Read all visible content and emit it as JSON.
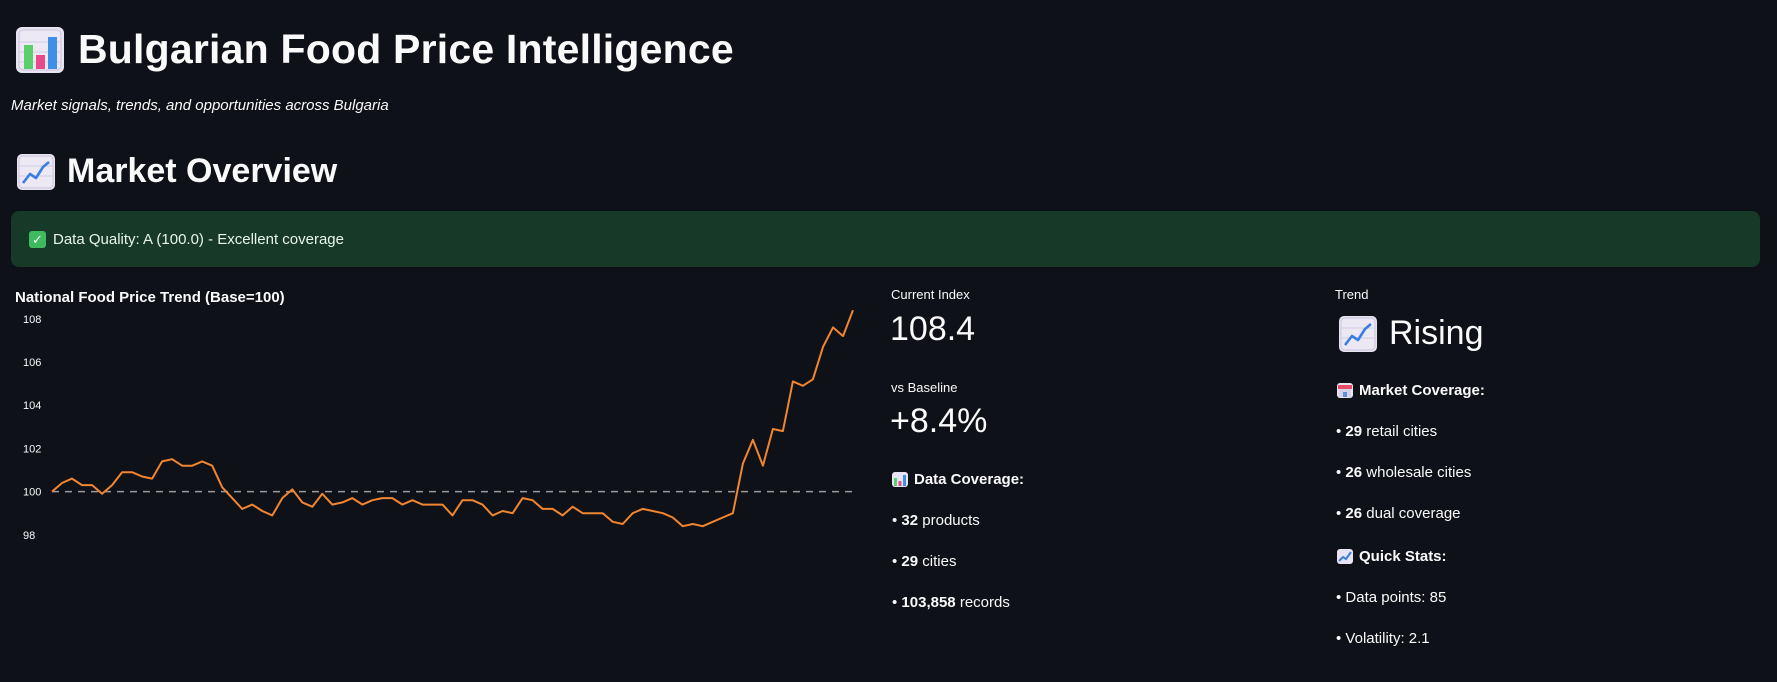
{
  "header": {
    "title": "Bulgarian Food Price Intelligence",
    "title_icon": "bar-chart-icon",
    "subtitle": "Market signals, trends, and opportunities across Bulgaria"
  },
  "section": {
    "title": "Market Overview",
    "icon": "chart-increasing-icon"
  },
  "alert": {
    "text": "Data Quality: A (100.0) - Excellent coverage",
    "icon": "check-mark-icon",
    "background": "#173928"
  },
  "colors": {
    "background": "#0e1117",
    "line": "#f2852f",
    "baseline": "#9a9a9a"
  },
  "metrics": {
    "current_index_label": "Current Index",
    "current_index_value": "108.4",
    "baseline_label": "vs Baseline",
    "baseline_value": "+8.4%",
    "trend_label": "Trend",
    "trend_value": "Rising",
    "trend_icon": "chart-increasing-icon"
  },
  "data_coverage": {
    "heading": "Data Coverage:",
    "icon": "bar-chart-icon",
    "items": [
      {
        "value": "32",
        "text": " products"
      },
      {
        "value": "29",
        "text": " cities"
      },
      {
        "value": "103,858",
        "text": " records"
      }
    ]
  },
  "market_coverage": {
    "heading": "Market Coverage:",
    "icon": "store-icon",
    "items": [
      {
        "value": "29",
        "text": " retail cities"
      },
      {
        "value": "26",
        "text": " wholesale cities"
      },
      {
        "value": "26",
        "text": " dual coverage"
      }
    ]
  },
  "quick_stats": {
    "heading": "Quick Stats:",
    "icon": "chart-increasing-icon",
    "items": [
      "• Data points: 85",
      "• Volatility: 2.1"
    ]
  },
  "bullet_prefix": "• ",
  "chart_data": {
    "type": "line",
    "title": "National Food Price Trend (Base=100)",
    "xlabel": "",
    "ylabel": "",
    "ylim": [
      97,
      109
    ],
    "yticks": [
      98,
      100,
      102,
      104,
      106,
      108
    ],
    "baseline": 100,
    "grid": false,
    "x": [
      1,
      2,
      3,
      4,
      5,
      6,
      7,
      8,
      9,
      10,
      11,
      12,
      13,
      14,
      15,
      16,
      17,
      18,
      19,
      20,
      21,
      22,
      23,
      24,
      25,
      26,
      27,
      28,
      29,
      30,
      31,
      32,
      33,
      34,
      35,
      36,
      37,
      38,
      39,
      40,
      41,
      42,
      43,
      44,
      45,
      46,
      47,
      48,
      49,
      50,
      51,
      52,
      53,
      54,
      55,
      56,
      57,
      58,
      59,
      60,
      61,
      62,
      63,
      64,
      65,
      66,
      67,
      68,
      69,
      70,
      71,
      72,
      73,
      74,
      75,
      76,
      77,
      78,
      79,
      80,
      81,
      82,
      83,
      84,
      85
    ],
    "series": [
      {
        "values": [
          100.0,
          100.4,
          100.6,
          100.3,
          100.3,
          99.9,
          100.3,
          100.9,
          100.9,
          100.7,
          100.6,
          101.4,
          101.5,
          101.2,
          101.2,
          101.4,
          101.2,
          100.2,
          99.7,
          99.2,
          99.4,
          99.1,
          98.9,
          99.7,
          100.1,
          99.5,
          99.3,
          99.9,
          99.4,
          99.5,
          99.7,
          99.4,
          99.6,
          99.7,
          99.7,
          99.4,
          99.6,
          99.4,
          99.4,
          99.4,
          98.9,
          99.6,
          99.6,
          99.4,
          98.9,
          99.1,
          99.0,
          99.7,
          99.6,
          99.2,
          99.2,
          98.9,
          99.3,
          99.0,
          99.0,
          99.0,
          98.6,
          98.5,
          99.0,
          99.2,
          99.1,
          99.0,
          98.8,
          98.4,
          98.5,
          98.4,
          98.6,
          98.8,
          99.0,
          101.3,
          102.4,
          101.2,
          102.9,
          102.8,
          105.1,
          104.9,
          105.2,
          106.7,
          107.6,
          107.2,
          108.4,
          108.4,
          108.4,
          108.4,
          108.4
        ]
      }
    ]
  }
}
